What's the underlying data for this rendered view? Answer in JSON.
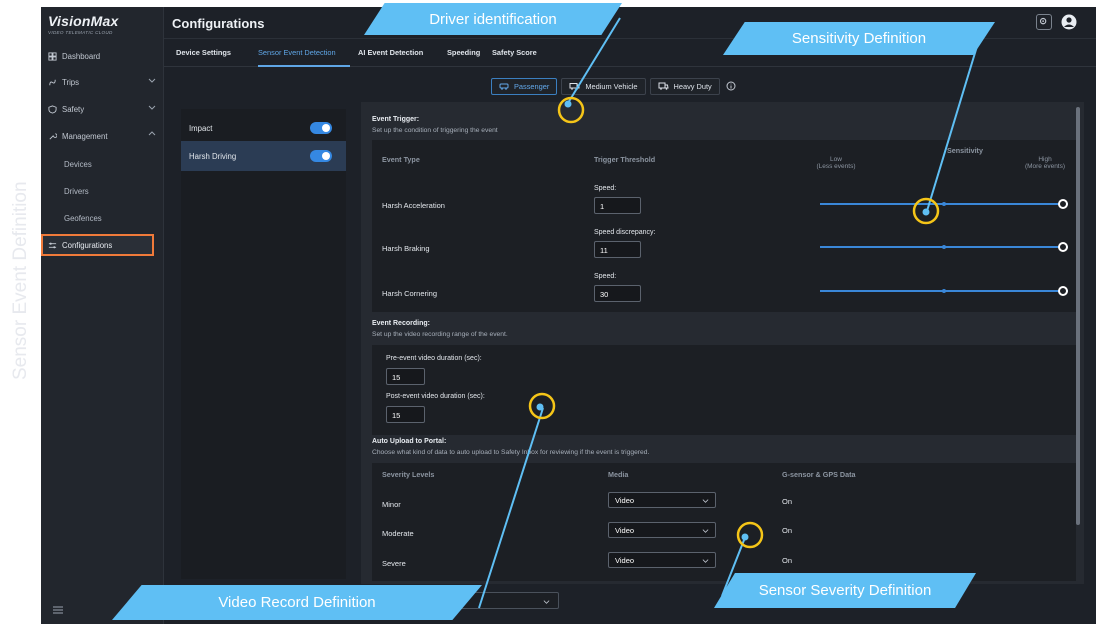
{
  "watermark": "Sensor Event Definition",
  "sidebar": {
    "logo": "VisionMax",
    "logo_sub": "VIDEO TELEMATIC CLOUD",
    "items": [
      {
        "label": "Dashboard",
        "icon": "dashboard-icon"
      },
      {
        "label": "Trips",
        "icon": "trips-icon"
      },
      {
        "label": "Safety",
        "icon": "safety-icon"
      },
      {
        "label": "Management",
        "icon": "management-icon"
      }
    ],
    "sub_items": [
      "Devices",
      "Drivers",
      "Geofences"
    ],
    "active_item": "Configurations"
  },
  "header": {
    "title": "Configurations"
  },
  "tabs": [
    {
      "label": "Device Settings",
      "active": false
    },
    {
      "label": "Sensor Event Detection",
      "active": true
    },
    {
      "label": "AI Event Detection",
      "active": false
    },
    {
      "label": "Speeding",
      "active": false
    },
    {
      "label": "Safety Score",
      "active": false
    }
  ],
  "vehicle_types": [
    {
      "label": "Passenger",
      "active": true
    },
    {
      "label": "Medium Vehicle",
      "active": false
    },
    {
      "label": "Heavy Duty",
      "active": false
    }
  ],
  "events": [
    {
      "label": "Impact",
      "enabled": true
    },
    {
      "label": "Harsh Driving",
      "enabled": true
    }
  ],
  "event_trigger": {
    "title": "Event Trigger:",
    "desc": "Set up the condition of triggering the event",
    "col_type": "Event Type",
    "col_threshold": "Trigger Threshold",
    "col_sensitivity": "Sensitivity",
    "sens_low": "Low",
    "sens_low_sub": "(Less events)",
    "sens_high": "High",
    "sens_high_sub": "(More events)",
    "rows": [
      {
        "type": "Harsh Acceleration",
        "field": "Speed:",
        "value": "1",
        "sensitivity": 1.0
      },
      {
        "type": "Harsh Braking",
        "field": "Speed discrepancy:",
        "value": "11",
        "sensitivity": 1.0
      },
      {
        "type": "Harsh Cornering",
        "field": "Speed:",
        "value": "30",
        "sensitivity": 1.0
      }
    ]
  },
  "event_recording": {
    "title": "Event Recording:",
    "desc": "Set up the video recording range of the event.",
    "pre_label": "Pre-event video duration (sec):",
    "pre_value": "15",
    "post_label": "Post-event video duration (sec):",
    "post_value": "15"
  },
  "auto_upload": {
    "title": "Auto Upload to Portal:",
    "desc": "Choose what kind of data to auto upload to Safety Inbox for reviewing if the event is triggered.",
    "col_severity": "Severity Levels",
    "col_media": "Media",
    "col_gsensor": "G-sensor & GPS Data",
    "rows": [
      {
        "level": "Minor",
        "media": "Video",
        "gsensor": "On"
      },
      {
        "level": "Moderate",
        "media": "Video",
        "gsensor": "On"
      },
      {
        "level": "Severe",
        "media": "Video",
        "gsensor": "On"
      }
    ]
  },
  "callouts": {
    "driver": "Driver identification",
    "sensitivity": "Sensitivity Definition",
    "video": "Video Record Definition",
    "severity": "Sensor Severity Definition"
  },
  "colors": {
    "accent": "#3588e2",
    "callout": "#5fbff4",
    "highlight": "#f5c518",
    "active_nav_border": "#f07a3a"
  }
}
